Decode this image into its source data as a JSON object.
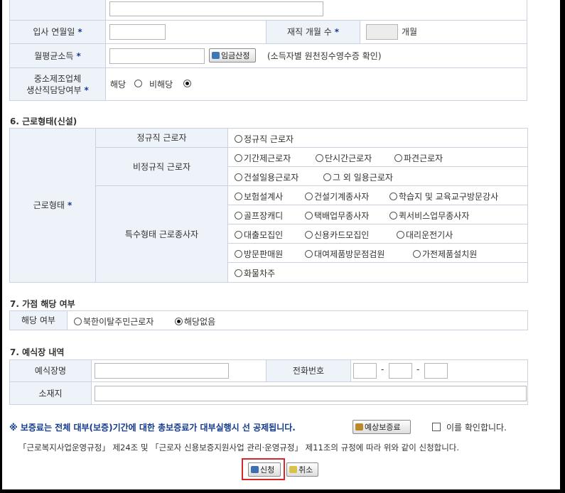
{
  "colors": {
    "label_bg": "#eef3fa",
    "border": "#c9d3e0",
    "required_star": "#1a3a8f",
    "highlight": "#d9262a"
  },
  "required_mark": "*",
  "employment": {
    "join_date_label": "입사 연월일",
    "months_label": "재직 개월 수",
    "months_unit": "개월",
    "income_label": "월평균소득",
    "calc_button": "임금산정",
    "income_note": "(소득자별 원천징수영수증 확인)",
    "sme_label_line1": "중소제조업체",
    "sme_label_line2": "생산직담당여부",
    "sme_options": [
      "해당",
      "비해당"
    ],
    "sme_selected": "비해당"
  },
  "section6": {
    "title": "6. 근로형태(신설)",
    "main_label": "근로형태",
    "regular_label": "정규직 근로자",
    "regular_options": [
      "정규직 근로자"
    ],
    "nonregular_label": "비정규직 근로자",
    "nonregular_row1": [
      "기간제근로자",
      "단시간근로자",
      "파견근로자"
    ],
    "nonregular_row2": [
      "건설일용근로자",
      "그 외 일용근로자"
    ],
    "special_label": "특수형태 근로종사자",
    "special_row1": [
      "보험설계사",
      "건설기계종사자",
      "학습지 및 교육교구방문강사"
    ],
    "special_row2": [
      "골프장캐디",
      "택배업무종사자",
      "퀵서비스업무종사자"
    ],
    "special_row3": [
      "대출모집인",
      "신용카드모집인",
      "대리운전기사"
    ],
    "special_row4": [
      "방문판매원",
      "대여제품방문점검원",
      "가전제품설치원"
    ],
    "special_row5": [
      "화물차주"
    ]
  },
  "section7": {
    "title": "7. 가점 해당 여부",
    "label": "해당 여부",
    "options": [
      "북한이탈주민근로자",
      "해당없음"
    ],
    "selected": "해당없음"
  },
  "section8": {
    "title": "7. 예식장 내역",
    "venue_label": "예식장명",
    "phone_label": "전화번호",
    "phone_sep": "-",
    "address_label": "소재지"
  },
  "footer": {
    "notice": "※ 보증료는 전체 대부(보증)기간에 대한 총보증료가 대부실행시 선 공제됩니다.",
    "estimate_button": "예상보증료",
    "confirm_label": "이를 확인합니다.",
    "regulation": "「근로복지사업운영규정」 제24조 및 「근로자 신용보증지원사업 관리·운영규정」 제11조의 규정에 따라 위와 같이 신청합니다.",
    "apply_button": "신청",
    "cancel_button": "취소"
  }
}
